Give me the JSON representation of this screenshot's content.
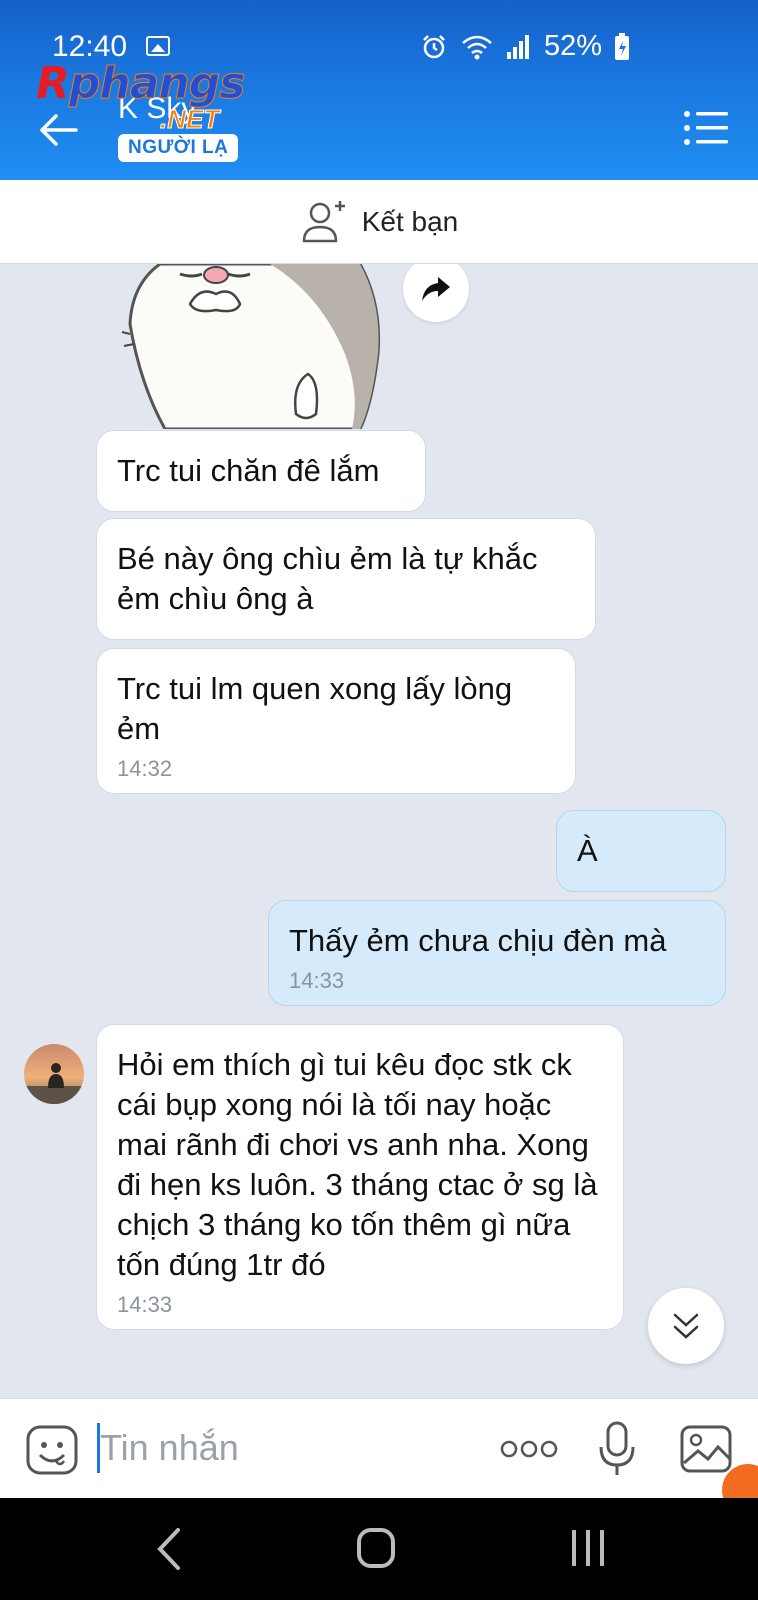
{
  "status_bar": {
    "time": "12:40",
    "battery": "52%",
    "icons": [
      "image-icon",
      "alarm-icon",
      "wifi-icon",
      "signal-icon",
      "battery-icon"
    ]
  },
  "header": {
    "contact_name": "K Sky",
    "stranger_badge": "NGƯỜI LẠ",
    "watermark_main_r": "R",
    "watermark_main_rest": "phangs",
    "watermark_net": ".NET",
    "colors": {
      "header_blue": "#1a78e0",
      "bubble_me": "#d5ebfb"
    }
  },
  "add_friend": {
    "label": "Kết bạn"
  },
  "messages": [
    {
      "sender": "them",
      "text": "Trc tui chăn đê lắm"
    },
    {
      "sender": "them",
      "text": "Bé này ông chìu ẻm là tự khắc ẻm chìu ông à"
    },
    {
      "sender": "them",
      "text": "Trc tui lm quen xong lấy lòng ẻm",
      "time": "14:32"
    },
    {
      "sender": "me",
      "text": "À"
    },
    {
      "sender": "me",
      "text": "Thấy ẻm chưa chịu đèn mà",
      "time": "14:33"
    },
    {
      "sender": "them",
      "text": "Hỏi em thích gì tui kêu đọc stk ck cái bụp xong nói là tối nay hoặc mai rãnh đi chơi vs anh nha. Xong đi hẹn ks luôn. 3 tháng ctac ở sg là chịch 3 tháng ko tốn thêm gì nữa tốn đúng 1tr đó",
      "time": "14:33"
    }
  ],
  "input": {
    "placeholder": "Tin nhắn"
  }
}
